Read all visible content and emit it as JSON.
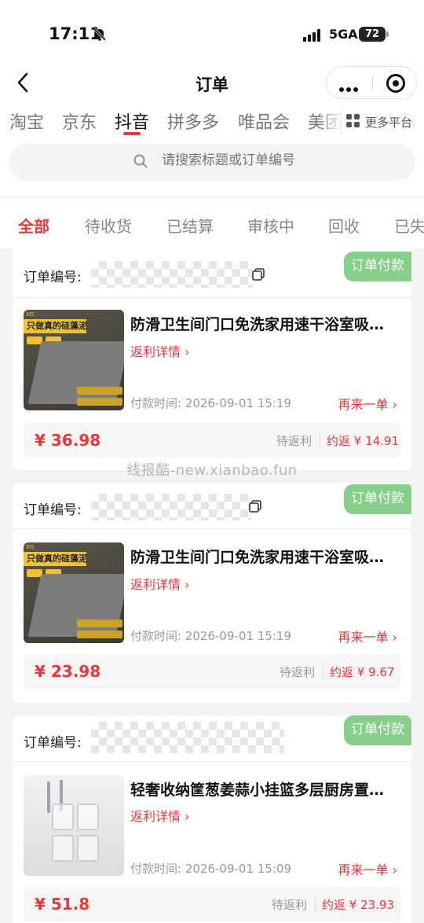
{
  "status_bar": {
    "time": "17:11",
    "network": "5GA",
    "battery": "72"
  },
  "nav": {
    "title": "订单"
  },
  "platform_tabs": [
    "淘宝",
    "京东",
    "抖音",
    "拼多多",
    "唯品会",
    "美团"
  ],
  "platform_active": "抖音",
  "more_platform": "更多平台",
  "search": {
    "placeholder": "请搜索标题或订单编号"
  },
  "status_tabs": [
    "全部",
    "待收货",
    "已结算",
    "审核中",
    "回收",
    "已失"
  ],
  "status_active": "全部",
  "orders": [
    {
      "order_label": "订单编号:",
      "badge": "订单付款",
      "title": "防滑卫生间门口免洗家用速干浴室吸…",
      "rebate_link": "返利详情 ›",
      "pay_time": "付款时间: 2026-09-01 15:19",
      "reorder": "再来一单 ›",
      "price": "¥ 36.98",
      "pending": "待返利",
      "about": "约返 ¥ 14.91",
      "image_text": "只做真的硅藻泥"
    },
    {
      "order_label": "订单编号:",
      "badge": "订单付款",
      "title": "防滑卫生间门口免洗家用速干浴室吸…",
      "rebate_link": "返利详情 ›",
      "pay_time": "付款时间: 2026-09-01 15:19",
      "reorder": "再来一单 ›",
      "price": "¥ 23.98",
      "pending": "待返利",
      "about": "约返 ¥ 9.67",
      "image_text": "只做真的硅藻泥"
    },
    {
      "order_label": "订单编号:",
      "badge": "订单付款",
      "title": "轻奢收纳筐葱姜蒜小挂篮多层厨房置…",
      "rebate_link": "返利详情 ›",
      "pay_time": "付款时间: 2026-09-01 15:09",
      "reorder": "再来一单 ›",
      "price": "¥ 51.8",
      "pending": "待返利",
      "about": "约返 ¥ 23.93"
    }
  ],
  "watermark": "线报酷-new.xianbao.fun",
  "colors": {
    "accent": "#e8383c",
    "badge": "#86cf8a",
    "background": "#f3f3f5"
  }
}
